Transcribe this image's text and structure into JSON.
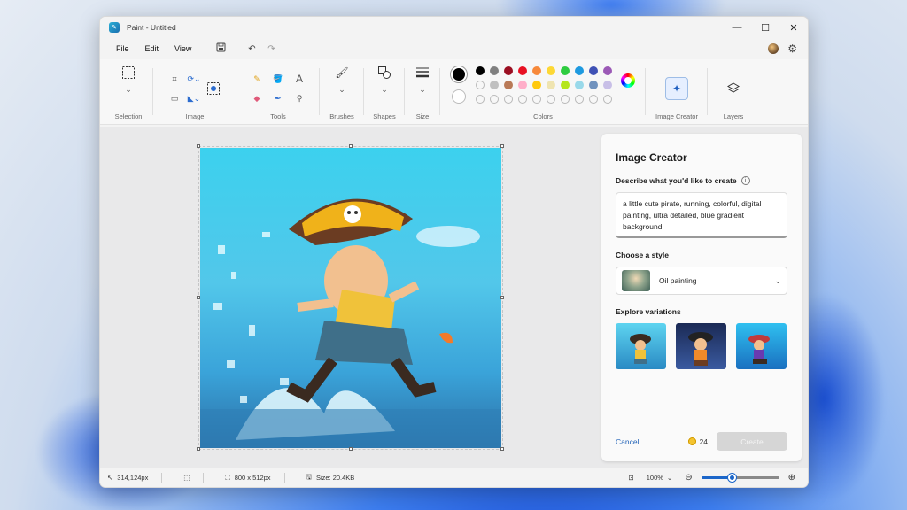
{
  "window": {
    "title": "Paint - Untitled",
    "controls": {
      "minimize": "—",
      "maximize": "☐",
      "close": "✕"
    }
  },
  "menu": {
    "items": [
      "File",
      "Edit",
      "View"
    ]
  },
  "ribbon": {
    "groups": {
      "selection": "Selection",
      "image": "Image",
      "tools": "Tools",
      "brushes": "Brushes",
      "shapes": "Shapes",
      "size": "Size",
      "colors": "Colors",
      "image_creator": "Image Creator",
      "layers": "Layers"
    },
    "palette": [
      "#000000",
      "#808080",
      "#9b0f22",
      "#e81123",
      "#f7893b",
      "#fdd835",
      "#2ecc40",
      "#1e9ae0",
      "#3f51b5",
      "#9b59b6",
      "empty",
      "#c0c0c0",
      "#b97a57",
      "#ffaec9",
      "#ffc90e",
      "#efe4b0",
      "#b5e61d",
      "#99d9ea",
      "#7092be",
      "#c8bfe7",
      "empty",
      "empty",
      "empty",
      "empty",
      "empty",
      "empty",
      "empty",
      "empty",
      "empty",
      "empty"
    ]
  },
  "panel": {
    "title": "Image Creator",
    "describe_label": "Describe what you'd like to create",
    "info_glyph": "i",
    "prompt_text": "a little cute pirate, running, colorful, digital painting, ultra detailed, blue gradient background",
    "style_label": "Choose a style",
    "style_value": "Oil painting",
    "variations_label": "Explore variations",
    "cancel_label": "Cancel",
    "credits": "24",
    "create_label": "Create"
  },
  "status": {
    "cursor_pos": "314,124px",
    "canvas_size": "800  x  512px",
    "file_size": "Size: 20.4KB",
    "zoom": "100%",
    "zoom_fraction": 0.4
  },
  "colors": {
    "accent": "#1b66c9",
    "link": "#2364b8"
  }
}
